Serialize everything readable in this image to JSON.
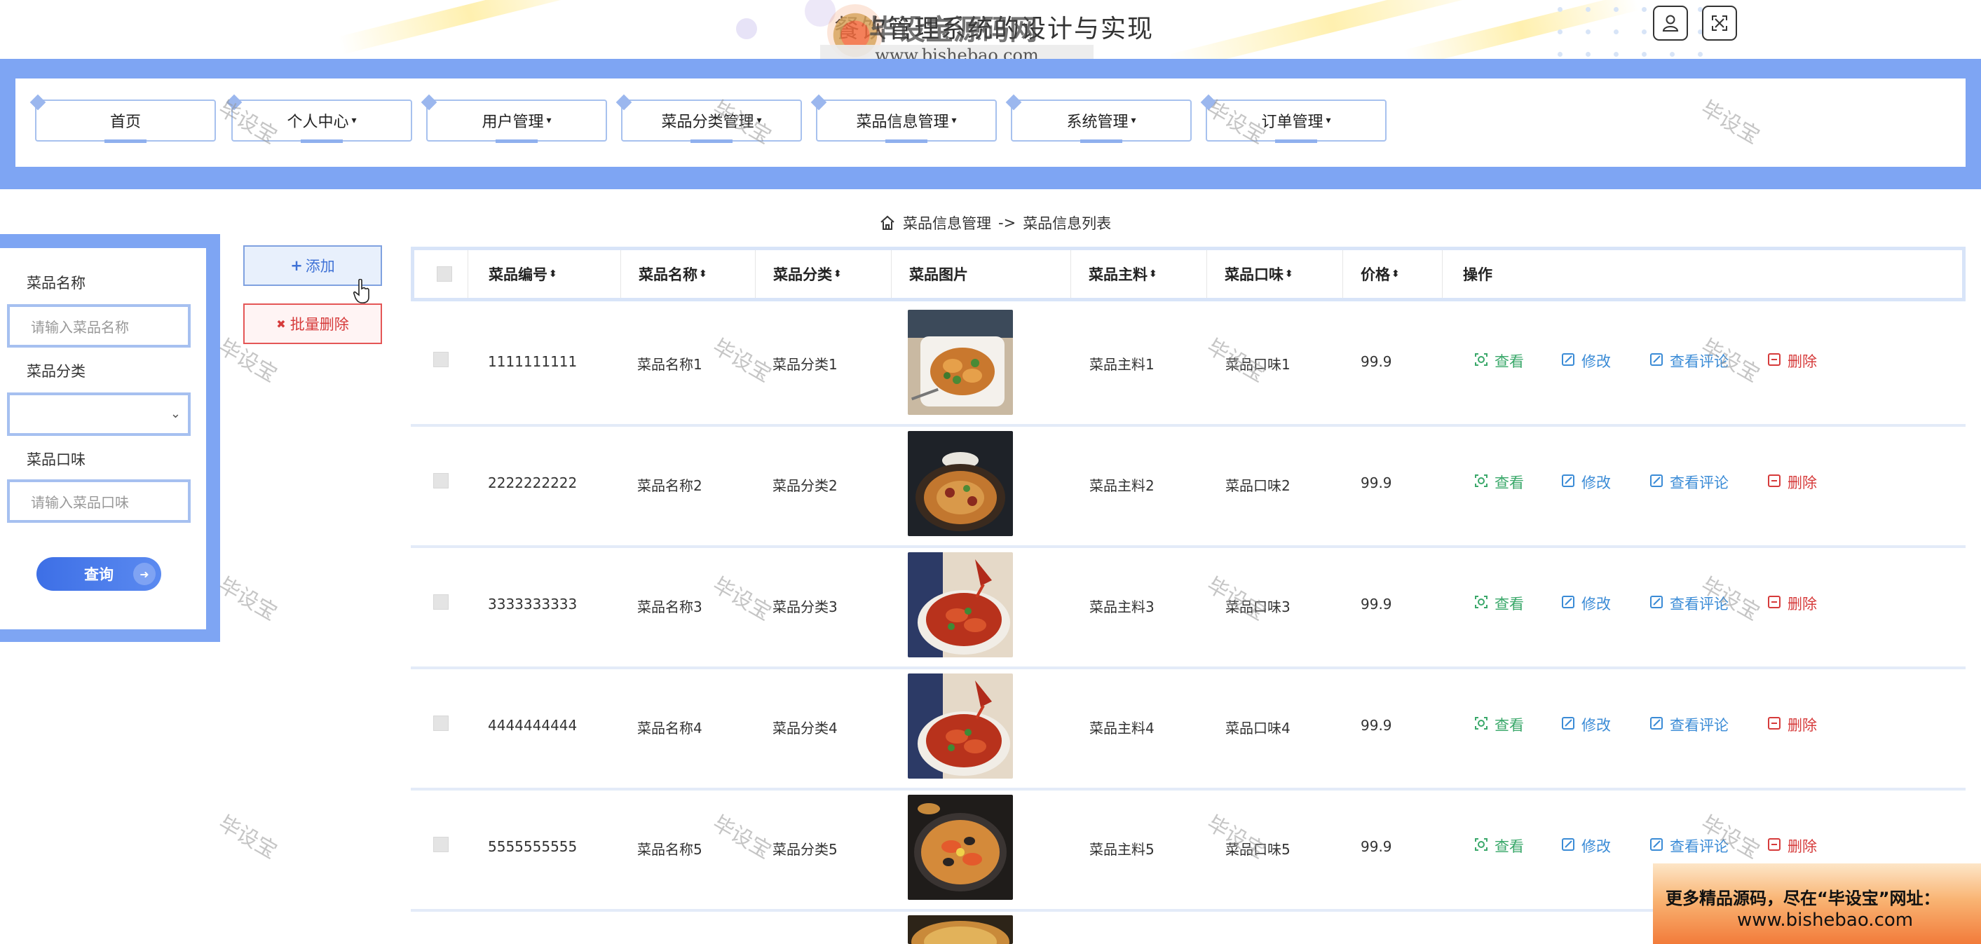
{
  "header": {
    "site_title": "餐饮管理系统的设计与实现",
    "watermark_brand": "毕设宝源码网",
    "watermark_url": "www.bishebao.com",
    "user_icon": "user-icon",
    "fullscreen_icon": "fullscreen-icon"
  },
  "nav": {
    "items": [
      {
        "label": "首页",
        "dropdown": false
      },
      {
        "label": "个人中心",
        "dropdown": true
      },
      {
        "label": "用户管理",
        "dropdown": true
      },
      {
        "label": "菜品分类管理",
        "dropdown": true
      },
      {
        "label": "菜品信息管理",
        "dropdown": true
      },
      {
        "label": "系统管理",
        "dropdown": true
      },
      {
        "label": "订单管理",
        "dropdown": true
      }
    ],
    "caret": "▾"
  },
  "breadcrumb": {
    "home_icon": "home-icon",
    "section": "菜品信息管理",
    "separator": "->",
    "page": "菜品信息列表"
  },
  "search": {
    "name_label": "菜品名称",
    "name_placeholder": "请输入菜品名称",
    "category_label": "菜品分类",
    "category_value": "",
    "taste_label": "菜品口味",
    "taste_placeholder": "请输入菜品口味",
    "query_label": "查询"
  },
  "actions": {
    "add_label": "添加",
    "add_icon": "+",
    "batch_delete_label": "批量删除",
    "batch_delete_icon": "✖"
  },
  "table": {
    "columns": [
      "菜品编号",
      "菜品名称",
      "菜品分类",
      "菜品图片",
      "菜品主料",
      "菜品口味",
      "价格",
      "操作"
    ],
    "sort_glyph": "⬍",
    "ops": {
      "view": "查看",
      "edit": "修改",
      "comment": "查看评论",
      "delete": "删除"
    },
    "rows": [
      {
        "id": "1111111111",
        "name": "菜品名称1",
        "category": "菜品分类1",
        "main": "菜品主料1",
        "taste": "菜品口味1",
        "price": "99.9",
        "image": "stir-fry-dish"
      },
      {
        "id": "2222222222",
        "name": "菜品名称2",
        "category": "菜品分类2",
        "main": "菜品主料2",
        "taste": "菜品口味2",
        "price": "99.9",
        "image": "noodle-bowl"
      },
      {
        "id": "3333333333",
        "name": "菜品名称3",
        "category": "菜品分类3",
        "main": "菜品主料3",
        "taste": "菜品口味3",
        "price": "99.9",
        "image": "spicy-crayfish"
      },
      {
        "id": "4444444444",
        "name": "菜品名称4",
        "category": "菜品分类4",
        "main": "菜品主料4",
        "taste": "菜品口味4",
        "price": "99.9",
        "image": "spicy-crayfish"
      },
      {
        "id": "5555555555",
        "name": "菜品名称5",
        "category": "菜品分类5",
        "main": "菜品主料5",
        "taste": "菜品口味5",
        "price": "99.9",
        "image": "paella-pan"
      }
    ]
  },
  "watermark_text": "毕设宝",
  "promo": {
    "line1": "更多精品源码，尽在“毕设宝”网址：",
    "line2": "www.bishebao.com"
  },
  "colors": {
    "nav_band": "#7ea5f3",
    "primary": "#3d6fe6",
    "view": "#3aa86a",
    "edit": "#3a8bd6",
    "danger": "#d63b3b"
  }
}
